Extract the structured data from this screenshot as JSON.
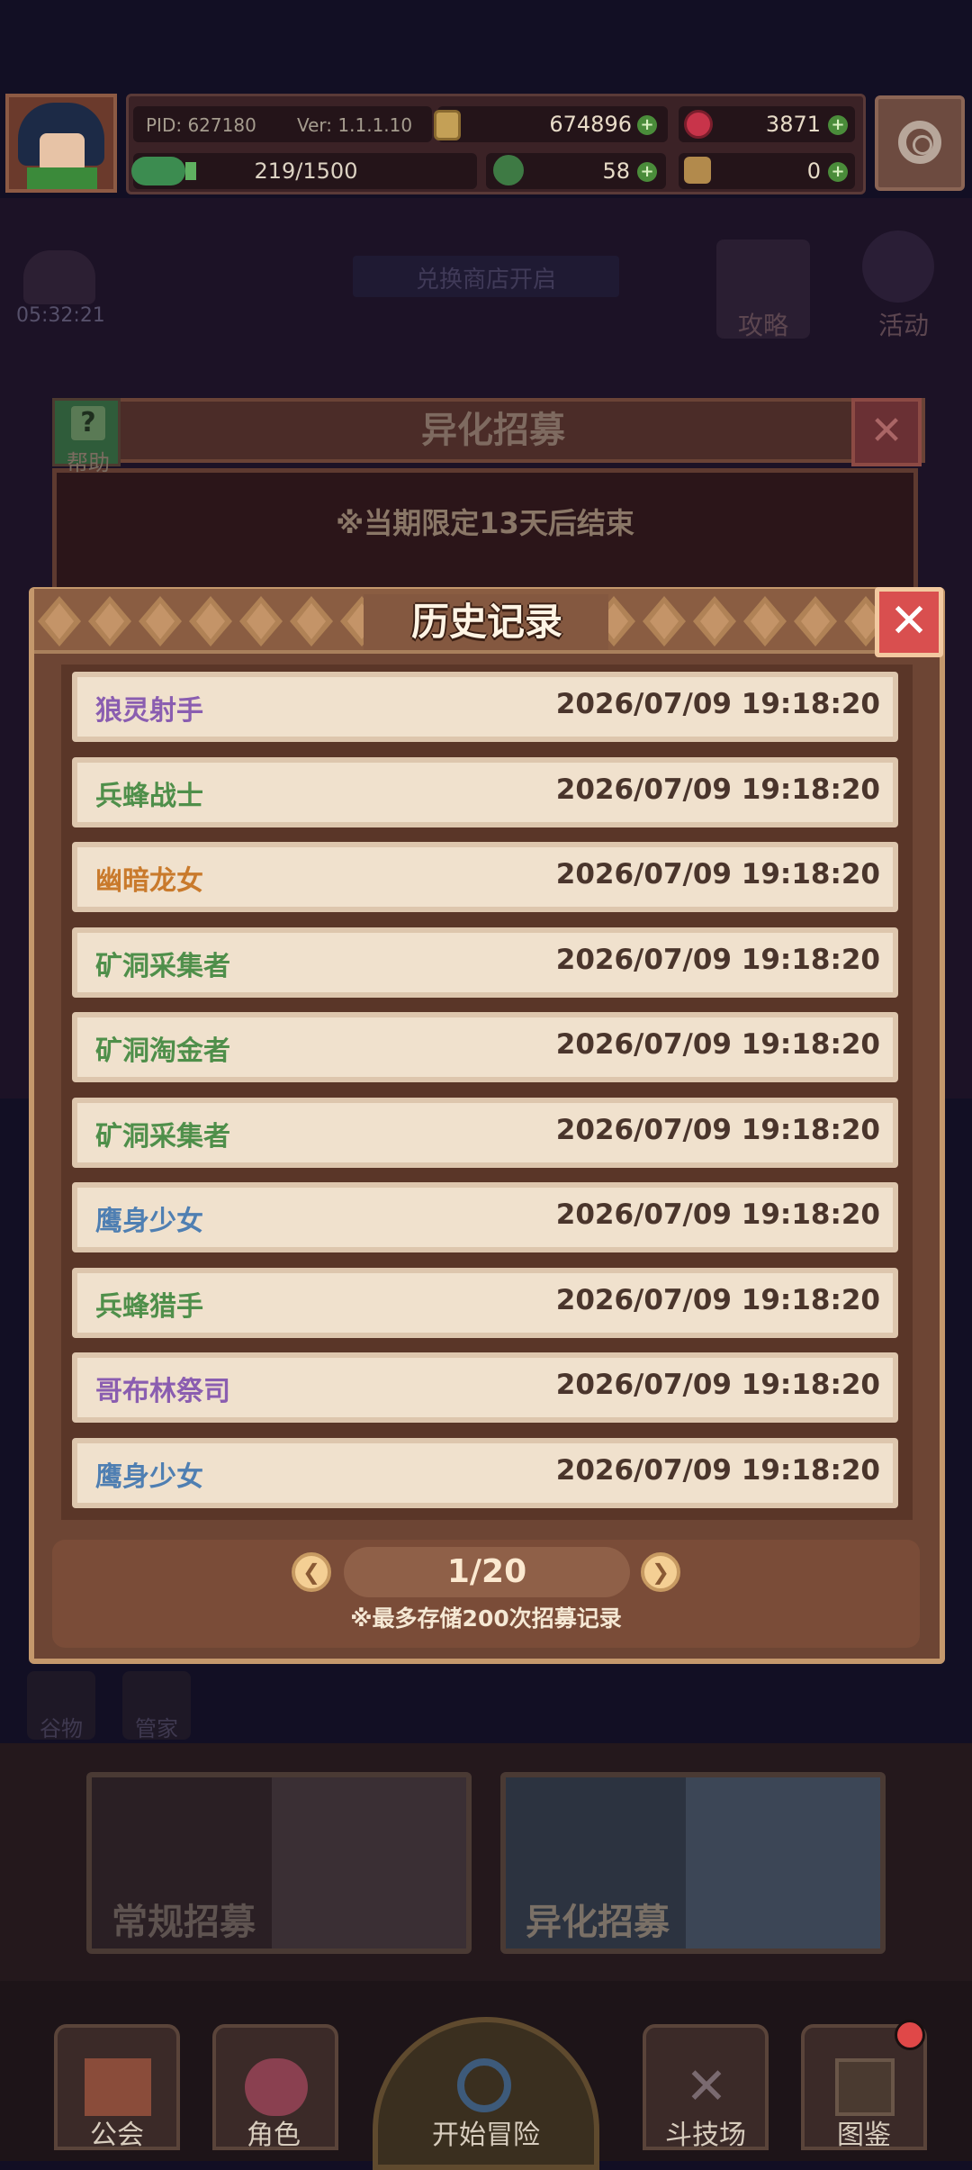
{
  "top_bar": {
    "pid": "PID: 627180",
    "version": "Ver: 1.1.1.10",
    "gold": "674896",
    "gems": "3871",
    "stamina": "219/1500",
    "clover": "58",
    "key": "0"
  },
  "background": {
    "timer": "05:32:21",
    "shop_label": "兑换商店开启",
    "guide": "攻略",
    "event": "活动",
    "left_btn1": "谷物",
    "left_btn2": "管家"
  },
  "back_dialog": {
    "title": "异化招募",
    "help": "帮助",
    "note": "※当期限定13天后结束"
  },
  "history_modal": {
    "title": "历史记录",
    "records": [
      {
        "name": "狼灵射手",
        "time": "2026/07/09 19:18:20",
        "color": "#8a5db0"
      },
      {
        "name": "兵蜂战士",
        "time": "2026/07/09 19:18:20",
        "color": "#4f8f4a"
      },
      {
        "name": "幽暗龙女",
        "time": "2026/07/09 19:18:20",
        "color": "#c97a2c"
      },
      {
        "name": "矿洞采集者",
        "time": "2026/07/09 19:18:20",
        "color": "#4f8f4a"
      },
      {
        "name": "矿洞淘金者",
        "time": "2026/07/09 19:18:20",
        "color": "#4f8f4a"
      },
      {
        "name": "矿洞采集者",
        "time": "2026/07/09 19:18:20",
        "color": "#4f8f4a"
      },
      {
        "name": "鹰身少女",
        "time": "2026/07/09 19:18:20",
        "color": "#4f7fb2"
      },
      {
        "name": "兵蜂猎手",
        "time": "2026/07/09 19:18:20",
        "color": "#4f8f4a"
      },
      {
        "name": "哥布林祭司",
        "time": "2026/07/09 19:18:20",
        "color": "#8a5db0"
      },
      {
        "name": "鹰身少女",
        "time": "2026/07/09 19:18:20",
        "color": "#4f7fb2"
      }
    ],
    "page": "1/20",
    "note": "※最多存储200次招募记录"
  },
  "recruit_cards": {
    "normal": "常规招募",
    "special": "异化招募"
  },
  "nav": {
    "guild": "公会",
    "character": "角色",
    "adventure": "开始冒险",
    "arena": "斗技场",
    "codex": "图鉴"
  }
}
